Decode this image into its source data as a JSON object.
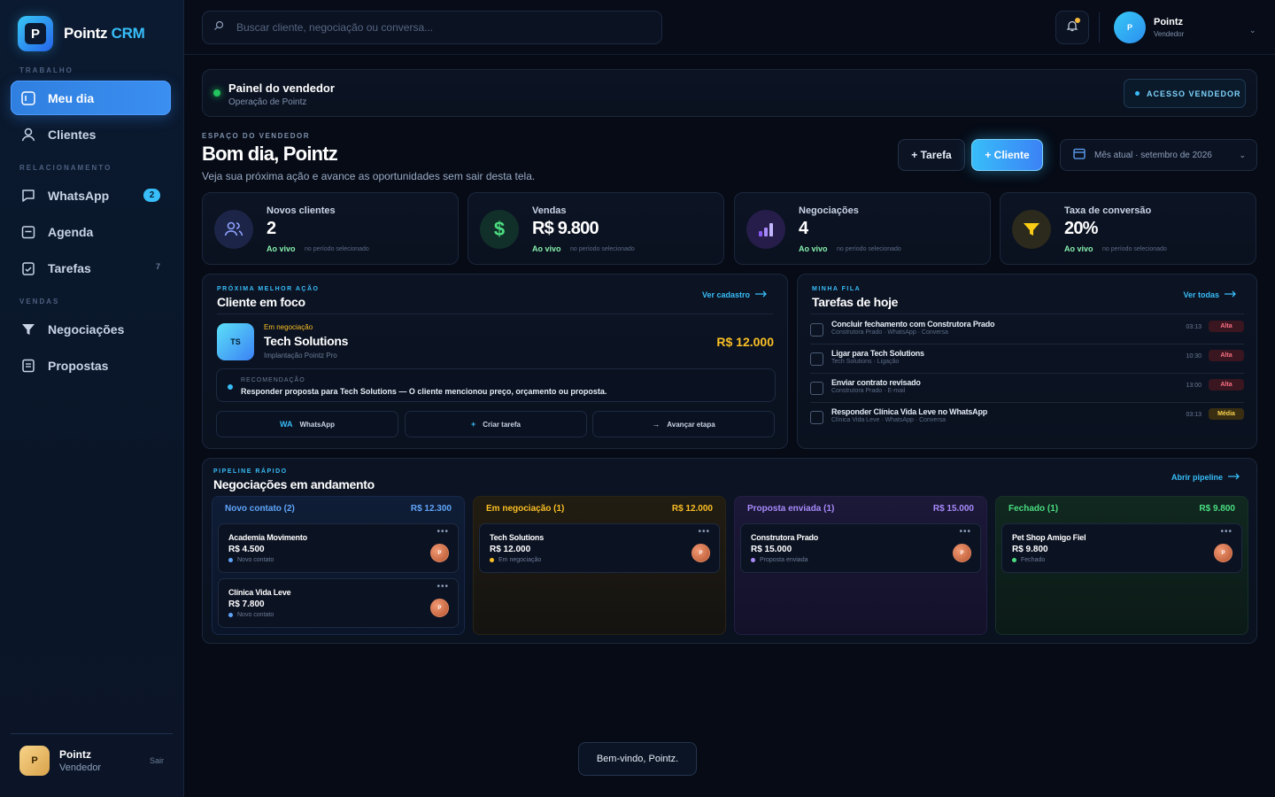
{
  "brand": {
    "name": "Pointz",
    "accent": "CRM",
    "logo_letter": "P"
  },
  "sidebar": {
    "sections": [
      "TRABALHO",
      "RELACIONAMENTO",
      "VENDAS"
    ],
    "items": [
      {
        "label": "Meu dia",
        "icon": "calendar-square-icon",
        "active": true
      },
      {
        "label": "Clientes",
        "icon": "user-icon"
      },
      {
        "label": "WhatsApp",
        "icon": "chat-icon",
        "badge": "2"
      },
      {
        "label": "Agenda",
        "icon": "calendar-icon"
      },
      {
        "label": "Tarefas",
        "icon": "clipboard-check-icon",
        "count": "7"
      },
      {
        "label": "Negociações",
        "icon": "funnel-icon"
      },
      {
        "label": "Propostas",
        "icon": "document-icon"
      }
    ],
    "user": {
      "initial": "P",
      "name": "Pointz",
      "role": "Vendedor",
      "logout": "Sair"
    }
  },
  "topbar": {
    "search_placeholder": "Buscar cliente, negociação ou conversa...",
    "user": {
      "initial": "P",
      "name": "Pointz",
      "role": "Vendedor"
    },
    "chevron": "⌄"
  },
  "panel": {
    "title": "Painel do vendedor",
    "subtitle": "Operação de Pointz",
    "access_badge": "ACESSO VENDEDOR"
  },
  "greeting": {
    "eyebrow": "ESPAÇO DO VENDEDOR",
    "title": "Bom dia, Pointz",
    "subtitle": "Veja sua próxima ação e avance as oportunidades sem sair desta tela.",
    "btn_task": "+ Tarefa",
    "btn_client": "+ Cliente",
    "period": "Mês atual · setembro de 2026"
  },
  "kpis": [
    {
      "label": "Novos clientes",
      "value": "2",
      "live": "Ao vivo",
      "note": "no período selecionado",
      "icon": "users-icon",
      "color": "#6d8bff"
    },
    {
      "label": "Vendas",
      "value": "R$ 9.800",
      "live": "Ao vivo",
      "note": "no período selecionado",
      "icon": "dollar-icon",
      "color": "#4ade80"
    },
    {
      "label": "Negociações",
      "value": "4",
      "live": "Ao vivo",
      "note": "no período selecionado",
      "icon": "bar-chart-icon",
      "color": "#a78bfa"
    },
    {
      "label": "Taxa de conversão",
      "value": "20%",
      "live": "Ao vivo",
      "note": "no período selecionado",
      "icon": "funnel-icon",
      "color": "#facc15"
    }
  ],
  "focus": {
    "eyebrow": "PRÓXIMA MELHOR AÇÃO",
    "title": "Cliente em foco",
    "link": "Ver cadastro",
    "client_initials": "TS",
    "stage": "Em negociação",
    "name": "Tech Solutions",
    "product": "Implantação Pointz Pro",
    "value": "R$ 12.000",
    "reco_label": "RECOMENDAÇÃO",
    "reco_text": "Responder proposta para Tech Solutions — O cliente mencionou preço, orçamento ou proposta.",
    "actions": [
      {
        "icon": "WA",
        "label": "WhatsApp"
      },
      {
        "icon": "+",
        "label": "Criar tarefa"
      },
      {
        "icon": "→",
        "label": "Avançar etapa"
      }
    ]
  },
  "tasks": {
    "eyebrow": "MINHA FILA",
    "title": "Tarefas de hoje",
    "link": "Ver todas",
    "items": [
      {
        "title": "Concluir fechamento com Construtora Prado",
        "meta": "Construtora Prado · WhatsApp · Conversa",
        "time": "03:13",
        "priority": "Alta"
      },
      {
        "title": "Ligar para Tech Solutions",
        "meta": "Tech Solutions · Ligação",
        "time": "10:30",
        "priority": "Alta"
      },
      {
        "title": "Enviar contrato revisado",
        "meta": "Construtora Prado · E-mail",
        "time": "13:00",
        "priority": "Alta"
      },
      {
        "title": "Responder Clínica Vida Leve no WhatsApp",
        "meta": "Clínica Vida Leve · WhatsApp · Conversa",
        "time": "03:13",
        "priority": "Média"
      }
    ]
  },
  "pipeline": {
    "eyebrow": "PIPELINE RÁPIDO",
    "title": "Negociações em andamento",
    "link": "Abrir pipeline",
    "columns": [
      {
        "name": "Novo contato (2)",
        "total": "R$ 12.300",
        "color": "#60a5fa",
        "deals": [
          {
            "name": "Academia Movimento",
            "value": "R$ 4.500",
            "stage": "Novo contato",
            "avatar": "P"
          },
          {
            "name": "Clínica Vida Leve",
            "value": "R$ 7.800",
            "stage": "Novo contato",
            "avatar": "P"
          }
        ]
      },
      {
        "name": "Em negociação (1)",
        "total": "R$ 12.000",
        "color": "#fbbf24",
        "deals": [
          {
            "name": "Tech Solutions",
            "value": "R$ 12.000",
            "stage": "Em negociação",
            "avatar": "P"
          }
        ]
      },
      {
        "name": "Proposta enviada (1)",
        "total": "R$ 15.000",
        "color": "#a78bfa",
        "deals": [
          {
            "name": "Construtora Prado",
            "value": "R$ 15.000",
            "stage": "Proposta enviada",
            "avatar": "P"
          }
        ]
      },
      {
        "name": "Fechado (1)",
        "total": "R$ 9.800",
        "color": "#4ade80",
        "deals": [
          {
            "name": "Pet Shop Amigo Fiel",
            "value": "R$ 9.800",
            "stage": "Fechado",
            "avatar": "P"
          }
        ]
      }
    ]
  },
  "toast": "Bem-vindo, Pointz.",
  "colors": {
    "accent": "#38bdf8",
    "active_nav": "#2f7fe0",
    "background": "#060b16",
    "success": "#22c55e",
    "warning": "#fbbf24",
    "danger": "#fb7185"
  }
}
